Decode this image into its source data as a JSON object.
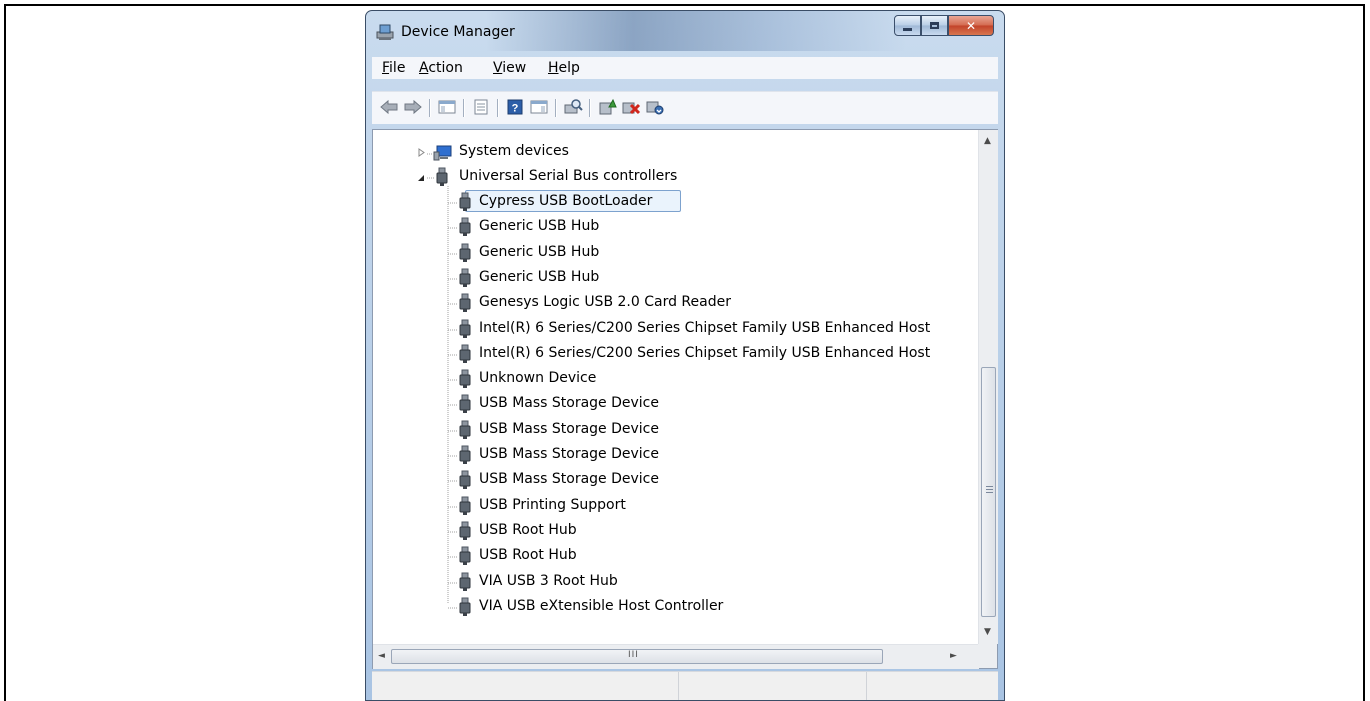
{
  "window": {
    "title": "Device Manager",
    "icon": "device-manager-icon"
  },
  "caption_buttons": [
    "minimize",
    "maximize",
    "close"
  ],
  "menu": {
    "items": [
      {
        "label": "File",
        "accel": "F"
      },
      {
        "label": "Action",
        "accel": "A"
      },
      {
        "label": "View",
        "accel": "V"
      },
      {
        "label": "Help",
        "accel": "H"
      }
    ]
  },
  "toolbar": {
    "buttons": [
      "back-icon",
      "forward-icon",
      "show-hide-console-tree-icon",
      "properties-icon",
      "help-icon",
      "action-pane-icon",
      "scan-hardware-icon",
      "update-driver-icon",
      "disable-device-icon",
      "uninstall-device-icon"
    ]
  },
  "tree": {
    "system_devices": "System devices",
    "usb_controllers": "Universal Serial Bus controllers",
    "usb_children": [
      "Cypress USB BootLoader",
      "Generic USB Hub",
      "Generic USB Hub",
      "Generic USB Hub",
      "Genesys Logic USB 2.0 Card Reader",
      "Intel(R) 6 Series/C200 Series Chipset Family USB Enhanced Host",
      "Intel(R) 6 Series/C200 Series Chipset Family USB Enhanced Host",
      "Unknown Device",
      "USB Mass Storage Device",
      "USB Mass Storage Device",
      "USB Mass Storage Device",
      "USB Mass Storage Device",
      "USB Printing Support",
      "USB Root Hub",
      "USB Root Hub",
      "VIA USB 3 Root Hub",
      "VIA USB eXtensible Host Controller"
    ],
    "selected": "Cypress USB BootLoader"
  },
  "scrollbar": {
    "h_thumb_glyph": "III",
    "v_thumb_glyph": "≡"
  },
  "colors": {
    "selection_bg": "#eaf3fc",
    "selection_border": "#7da2ce",
    "close_button": "#c2422a"
  }
}
